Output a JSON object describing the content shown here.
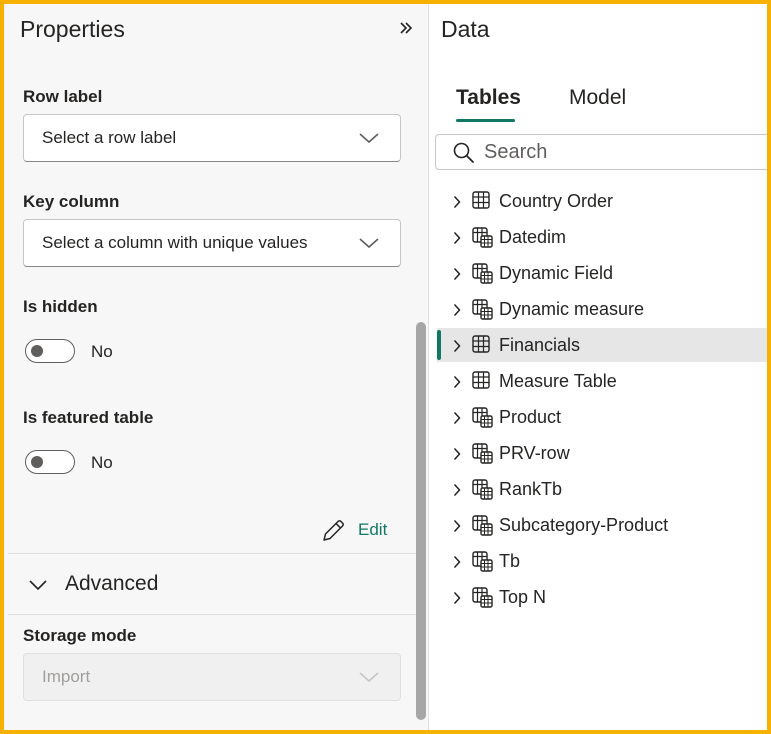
{
  "properties": {
    "title": "Properties",
    "row_label": {
      "label": "Row label",
      "placeholder": "Select a row label"
    },
    "key_column": {
      "label": "Key column",
      "placeholder": "Select a column with unique values"
    },
    "is_hidden": {
      "label": "Is hidden",
      "value": "No"
    },
    "is_featured": {
      "label": "Is featured table",
      "value": "No"
    },
    "edit_label": "Edit",
    "advanced_label": "Advanced",
    "storage_mode": {
      "label": "Storage mode",
      "value": "Import"
    }
  },
  "data_pane": {
    "title": "Data",
    "tabs": [
      {
        "label": "Tables",
        "active": true
      },
      {
        "label": "Model",
        "active": false
      }
    ],
    "search_placeholder": "Search",
    "tables": [
      {
        "label": "Country Order",
        "icon": "table-icon"
      },
      {
        "label": "Datedim",
        "icon": "calculated-table-icon"
      },
      {
        "label": "Dynamic Field",
        "icon": "calculated-table-icon"
      },
      {
        "label": "Dynamic measure",
        "icon": "calculated-table-icon"
      },
      {
        "label": "Financials",
        "icon": "table-icon",
        "selected": true
      },
      {
        "label": "Measure Table",
        "icon": "table-icon"
      },
      {
        "label": "Product",
        "icon": "calculated-table-icon"
      },
      {
        "label": "PRV-row",
        "icon": "calculated-table-icon"
      },
      {
        "label": "RankTb",
        "icon": "calculated-table-icon"
      },
      {
        "label": "Subcategory-Product",
        "icon": "calculated-table-icon"
      },
      {
        "label": "Tb",
        "icon": "calculated-table-icon"
      },
      {
        "label": "Top N",
        "icon": "calculated-table-icon"
      }
    ]
  },
  "colors": {
    "accent": "#117865",
    "frame": "#f7b100",
    "pane_bg": "#f7f7f7",
    "selected_bg": "#e6e6e6"
  }
}
